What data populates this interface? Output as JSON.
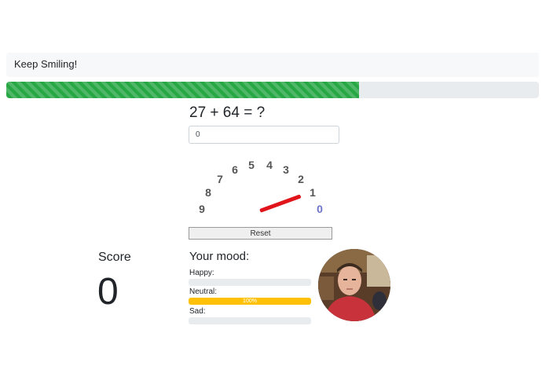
{
  "header": {
    "message": "Keep Smiling!"
  },
  "progress": {
    "percent": 66.2,
    "color": "#28a745"
  },
  "quiz": {
    "question": "27 + 64 = ?",
    "answer_value": "0",
    "reset_label": "Reset"
  },
  "dial": {
    "digits": [
      "9",
      "8",
      "7",
      "6",
      "5",
      "4",
      "3",
      "2",
      "1",
      "0"
    ],
    "active_digit": "0",
    "needle_color": "#e0141a",
    "active_color": "#6c73c9"
  },
  "score": {
    "label": "Score",
    "value": "0"
  },
  "mood": {
    "title": "Your mood:",
    "items": [
      {
        "label": "Happy:",
        "value_label": "0%",
        "percent": 0
      },
      {
        "label": "Neutral:",
        "value_label": "100%",
        "percent": 100
      },
      {
        "label": "Sad:",
        "value_label": "0%",
        "percent": 0
      }
    ],
    "bar_color": "#ffc107"
  },
  "avatar": {
    "icon": "webcam-face-photo"
  }
}
